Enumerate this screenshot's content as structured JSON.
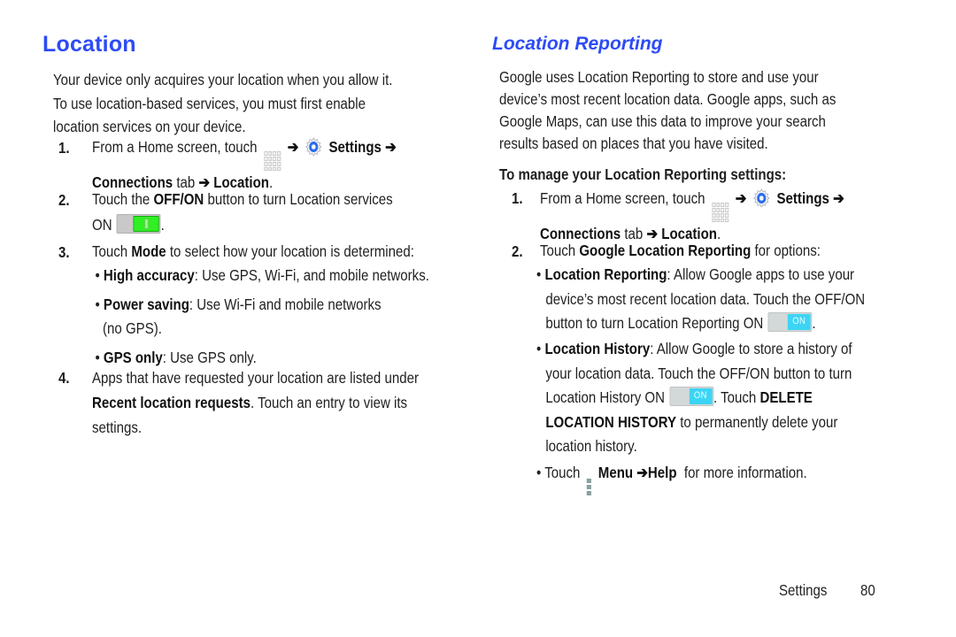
{
  "left": {
    "title": "Location",
    "intro": [
      "Your device only acquires your location when you allow it.",
      "To use location-based services, you must first enable",
      "location services on your device."
    ],
    "steps": [
      {
        "num": "1.",
        "text_a": "From a Home screen, touch",
        "arrow": "➔",
        "settings": "Settings",
        "arrow2": "➔",
        "connections": "Connections",
        "tab": " tab ",
        "arrow3": "➔",
        "location": "Location",
        "period": "."
      },
      {
        "num": "2.",
        "text_a": "Touch the ",
        "offon": "OFF/ON",
        "text_b": " button to turn Location services",
        "on_label": "ON",
        "period": "."
      },
      {
        "num": "3.",
        "text_a": "Touch ",
        "mode": "Mode",
        "text_b": " to select how your location is determined:",
        "bullets": [
          {
            "label": "High accuracy",
            "text": ": Use GPS, Wi-Fi, and mobile networks."
          },
          {
            "label": "Power saving",
            "text": ": Use Wi-Fi and mobile networks",
            "cont": "(no GPS)."
          },
          {
            "label": "GPS only",
            "text": ": Use GPS only."
          }
        ]
      },
      {
        "num": "4.",
        "line1": "Apps that have requested your location are listed under",
        "bold": "Recent location requests",
        "line2": ". Touch an entry to view its",
        "line3": "settings."
      }
    ]
  },
  "right": {
    "title": "Location Reporting",
    "intro": [
      "Google uses Location Reporting to store and use your",
      "device’s most recent location data. Google apps, such as",
      "Google Maps, can use this data to improve your search",
      "results based on places that you have visited."
    ],
    "subheading": "To manage your Location Reporting settings:",
    "steps": [
      {
        "num": "1.",
        "text_a": "From a Home screen, touch",
        "arrow": "➔",
        "settings": "Settings",
        "arrow2": "➔",
        "connections": "Connections",
        "tab": " tab ",
        "arrow3": "➔",
        "location": "Location",
        "period": "."
      },
      {
        "num": "2.",
        "text_a": "Touch ",
        "bold": "Google Location Reporting",
        "text_b": " for options:"
      }
    ],
    "bullets": {
      "reporting": {
        "label": "Location Reporting",
        "line1": ": Allow Google apps to use your",
        "line2": "device’s most recent location data. Touch the OFF/ON",
        "line3": "button to turn Location Reporting ON",
        "toggle": "ON",
        "period": "."
      },
      "history": {
        "label": "Location History",
        "line1": ": Allow Google to store a history of",
        "line2": "your location data. Touch the OFF/ON button to turn",
        "line3a": "Location History ON",
        "toggle": "ON",
        "line3b": ". Touch ",
        "delete": "DELETE",
        "delete2": "LOCATION HISTORY",
        "line4": " to permanently delete your",
        "line5": "location history."
      },
      "menu": {
        "touch": "Touch",
        "menu": "Menu",
        "arrow": "➔",
        "help": "Help",
        "text": "  for more information."
      }
    }
  },
  "footer": {
    "section": "Settings",
    "page": "80"
  },
  "colors": {
    "title": "#2d4bf5",
    "toggle_green": "#2ef022",
    "toggle_blue": "#3cd4f5"
  }
}
